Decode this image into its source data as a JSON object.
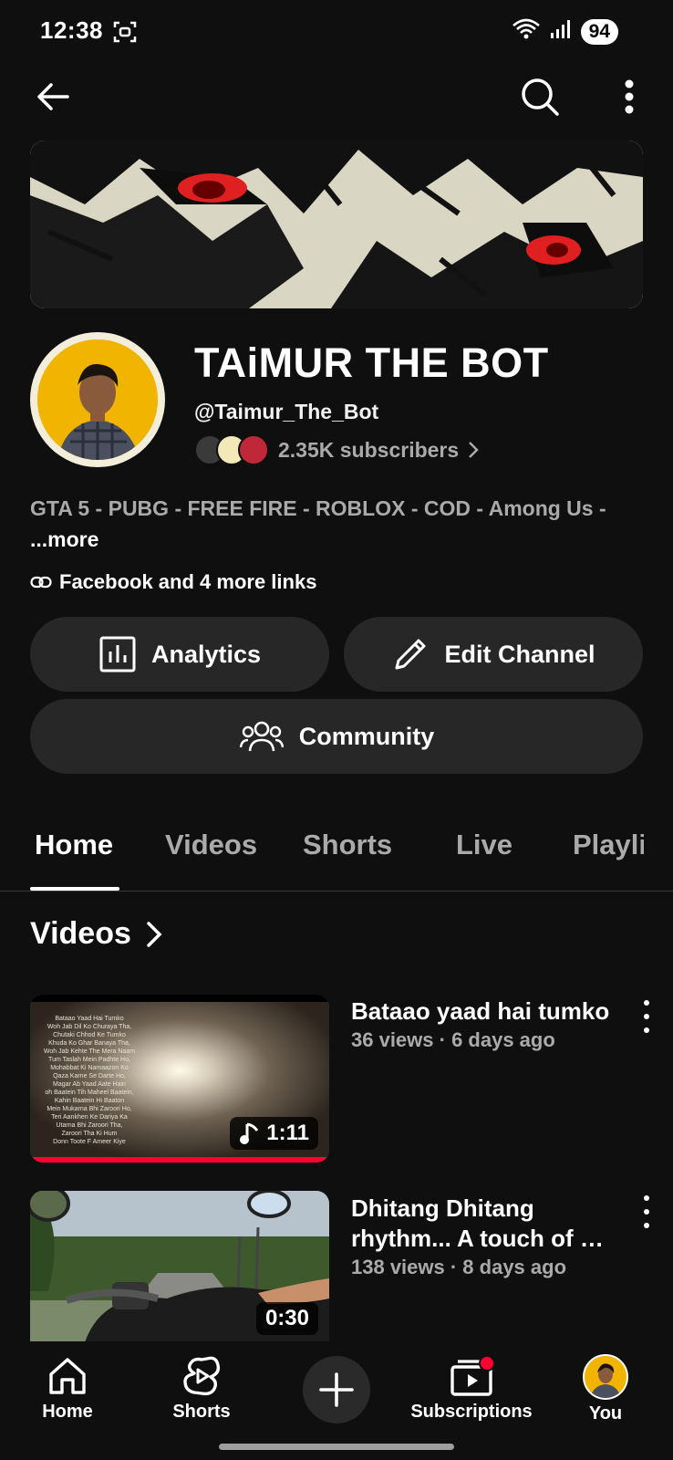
{
  "status_bar": {
    "time": "12:38",
    "battery": "94"
  },
  "channel": {
    "name": "TAiMUR THE BOT",
    "handle": "@Taimur_The_Bot",
    "subscribers": "2.35K subscribers",
    "description": "GTA 5 - PUBG - FREE FIRE - ROBLOX - COD - Among Us - ",
    "more_label": "...more",
    "links_text": "Facebook and 4 more links"
  },
  "actions": {
    "analytics": "Analytics",
    "edit_channel": "Edit Channel",
    "community": "Community"
  },
  "tabs": [
    {
      "label": "Home",
      "active": true
    },
    {
      "label": "Videos",
      "active": false
    },
    {
      "label": "Shorts",
      "active": false
    },
    {
      "label": "Live",
      "active": false
    },
    {
      "label": "Playli",
      "active": false
    }
  ],
  "videos_section": {
    "title": "Videos"
  },
  "videos": [
    {
      "title": "Bataao yaad hai tumko",
      "meta": "36 views · 6 days ago",
      "duration": "1:11",
      "thumb_lines": [
        "Bataao Yaad Hai Tumko",
        "Woh Jab Dil Ko Churaya Tha,",
        "Chutaki Chhod Ke Tumko",
        "Khuda Ko Ghar Banaya Tha,",
        "Woh Jab Kehte The Mera Naam",
        "Tum Taslah Mein Padhte Ho,",
        "Mohabbat Ki Namaazon Ko",
        "Qaza Karne Se Darte Ho,",
        "Magar Ab Yaad Aate Hain",
        "oh Baatein Tih Maheel Baatein,",
        "Kahin Baatein Hi Baaton",
        "Mein Mukarna Bhi Zaroori Ho,",
        "Teri Aankhen Ke Dariya Ka",
        "Utarna Bhi Zaroori Tha,",
        "Zaroori Tha Ki Hum",
        "Donn Toote F Ameer Kiye"
      ]
    },
    {
      "title": "Dhitang Dhitang rhythm... A touch of …",
      "meta": "138 views · 8 days ago",
      "duration": "0:30"
    }
  ],
  "bottom_nav": {
    "home": "Home",
    "shorts": "Shorts",
    "subscriptions": "Subscriptions",
    "you": "You"
  },
  "colors": {
    "background": "#0f0f0f",
    "button_bg": "#272727",
    "secondary_text": "#aaaaaa",
    "accent_red": "#ff0033"
  }
}
